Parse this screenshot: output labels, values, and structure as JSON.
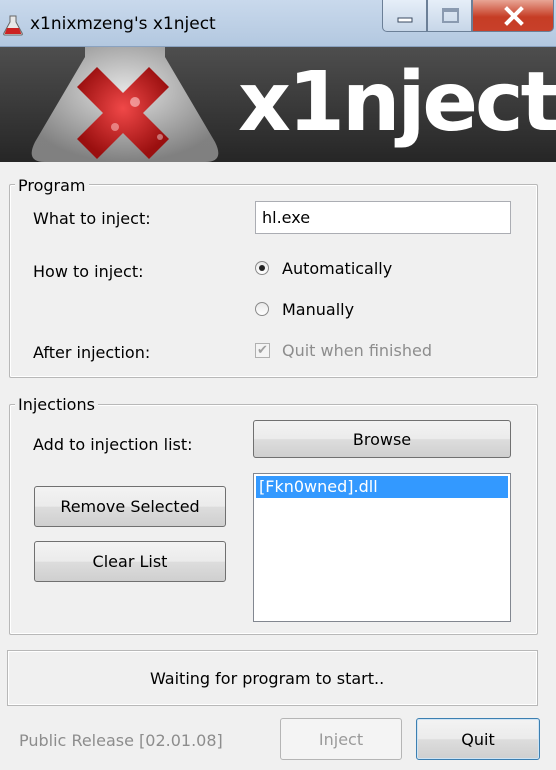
{
  "window": {
    "title": "x1nixmzeng's x1nject",
    "icon": "flask-icon"
  },
  "banner": {
    "logo_text": "x1nject"
  },
  "program": {
    "legend": "Program",
    "what_label": "What to inject:",
    "what_value": "hl.exe",
    "how_label": "How to inject:",
    "radio_auto": "Automatically",
    "radio_manual": "Manually",
    "selected_mode": "Automatically",
    "after_label": "After injection:",
    "quit_checkbox": "Quit when finished",
    "quit_checked": true
  },
  "injections": {
    "legend": "Injections",
    "add_label": "Add to injection list:",
    "browse_button": "Browse",
    "remove_button": "Remove Selected",
    "clear_button": "Clear List",
    "list_items": [
      "[Fkn0wned].dll"
    ]
  },
  "status": {
    "text": "Waiting for program to start.."
  },
  "footer": {
    "version": "Public Release [02.01.08]",
    "inject_button": "Inject",
    "quit_button": "Quit"
  },
  "colors": {
    "selection": "#3399ff",
    "close_button": "#c63d25"
  }
}
